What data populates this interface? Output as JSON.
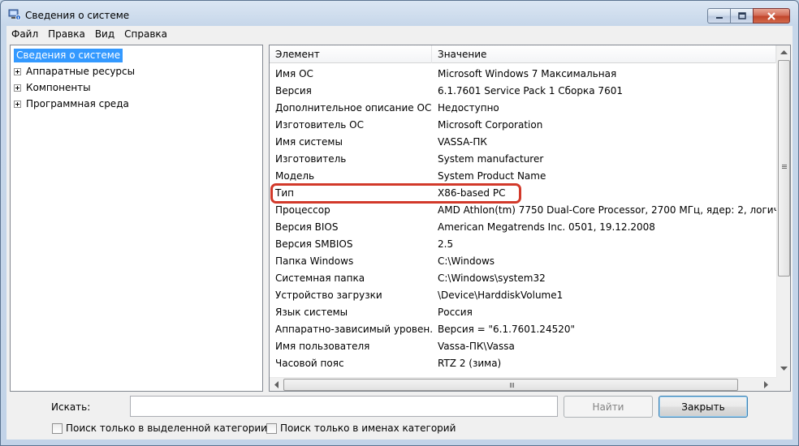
{
  "window": {
    "title": "Сведения о системе"
  },
  "menu": [
    "Файл",
    "Правка",
    "Вид",
    "Справка"
  ],
  "tree": {
    "selected": "Сведения о системе",
    "items": [
      "Аппаратные ресурсы",
      "Компоненты",
      "Программная среда"
    ]
  },
  "table": {
    "columns": [
      "Элемент",
      "Значение"
    ],
    "rows": [
      [
        "Имя ОС",
        "Microsoft Windows 7 Максимальная"
      ],
      [
        "Версия",
        "6.1.7601 Service Pack 1 Сборка 7601"
      ],
      [
        "Дополнительное описание ОС",
        "Недоступно"
      ],
      [
        "Изготовитель ОС",
        "Microsoft Corporation"
      ],
      [
        "Имя системы",
        "VASSA-ПК"
      ],
      [
        "Изготовитель",
        "System manufacturer"
      ],
      [
        "Модель",
        "System Product Name"
      ],
      [
        "Тип",
        "X86-based PC"
      ],
      [
        "Процессор",
        "AMD Athlon(tm) 7750 Dual-Core Processor, 2700 МГц, ядер: 2, логиче"
      ],
      [
        "Версия BIOS",
        "American Megatrends Inc. 0501, 19.12.2008"
      ],
      [
        "Версия SMBIOS",
        "2.5"
      ],
      [
        "Папка Windows",
        "C:\\Windows"
      ],
      [
        "Системная папка",
        "C:\\Windows\\system32"
      ],
      [
        "Устройство загрузки",
        "\\Device\\HarddiskVolume1"
      ],
      [
        "Язык системы",
        "Россия"
      ],
      [
        "Аппаратно-зависимый уровен...",
        "Версия = \"6.1.7601.24520\""
      ],
      [
        "Имя пользователя",
        "Vassa-ПК\\Vassa"
      ],
      [
        "Часовой пояс",
        "RTZ 2 (зима)"
      ]
    ]
  },
  "search": {
    "label": "Искать:",
    "value": "",
    "find_button": "Найти",
    "close_button": "Закрыть",
    "option_selected_category": "Поиск только в выделенной категории",
    "option_category_names": "Поиск только в именах категорий"
  },
  "colors": {
    "selection": "#3399ff",
    "highlight_border": "#d2392a"
  }
}
